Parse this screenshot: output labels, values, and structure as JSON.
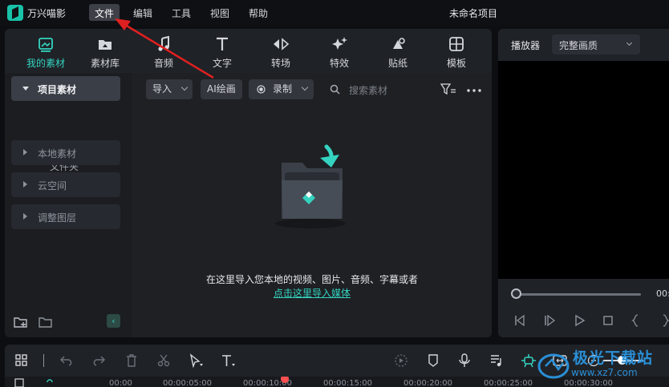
{
  "app": {
    "name": "万兴喵影",
    "project_title": "未命名项目"
  },
  "menu": {
    "items": [
      "文件",
      "编辑",
      "工具",
      "视图",
      "帮助"
    ],
    "active": "文件"
  },
  "media_tabs": [
    {
      "label": "我的素材",
      "icon": "my-media-icon",
      "active": true
    },
    {
      "label": "素材库",
      "icon": "stock-library-icon"
    },
    {
      "label": "音频",
      "icon": "music-note-icon"
    },
    {
      "label": "文字",
      "icon": "text-t-icon"
    },
    {
      "label": "转场",
      "icon": "transition-icon"
    },
    {
      "label": "特效",
      "icon": "effects-sparkle-icon"
    },
    {
      "label": "贴纸",
      "icon": "sticker-icon"
    },
    {
      "label": "模板",
      "icon": "template-grid-icon"
    }
  ],
  "tree": {
    "project_media": "项目素材",
    "folder": "文件夹",
    "local_media": "本地素材",
    "cloud": "云空间",
    "adjustment_layer": "调整图层"
  },
  "library": {
    "import_label": "导入",
    "ai_paint_label": "AI绘画",
    "record_label": "录制",
    "search_placeholder": "搜索素材",
    "empty_text": "在这里导入您本地的视频、图片、音频、字幕或者",
    "empty_link": "点击这里导入媒体"
  },
  "player": {
    "title": "播放器",
    "quality": "完整画质",
    "time_readout": "00:"
  },
  "timeline": {
    "ruler_labels": [
      "00:00",
      "00:00:05:00",
      "00:00:10:00",
      "00:00:15:00",
      "00:00:20:00",
      "00:00:25:00",
      "00:00:30:00"
    ]
  },
  "watermark": {
    "text": "极光下载站",
    "url": "www.xz7.com"
  },
  "colors": {
    "accent": "#34d3c0",
    "annotation": "#e02020",
    "playhead": "#ff4f4f"
  }
}
